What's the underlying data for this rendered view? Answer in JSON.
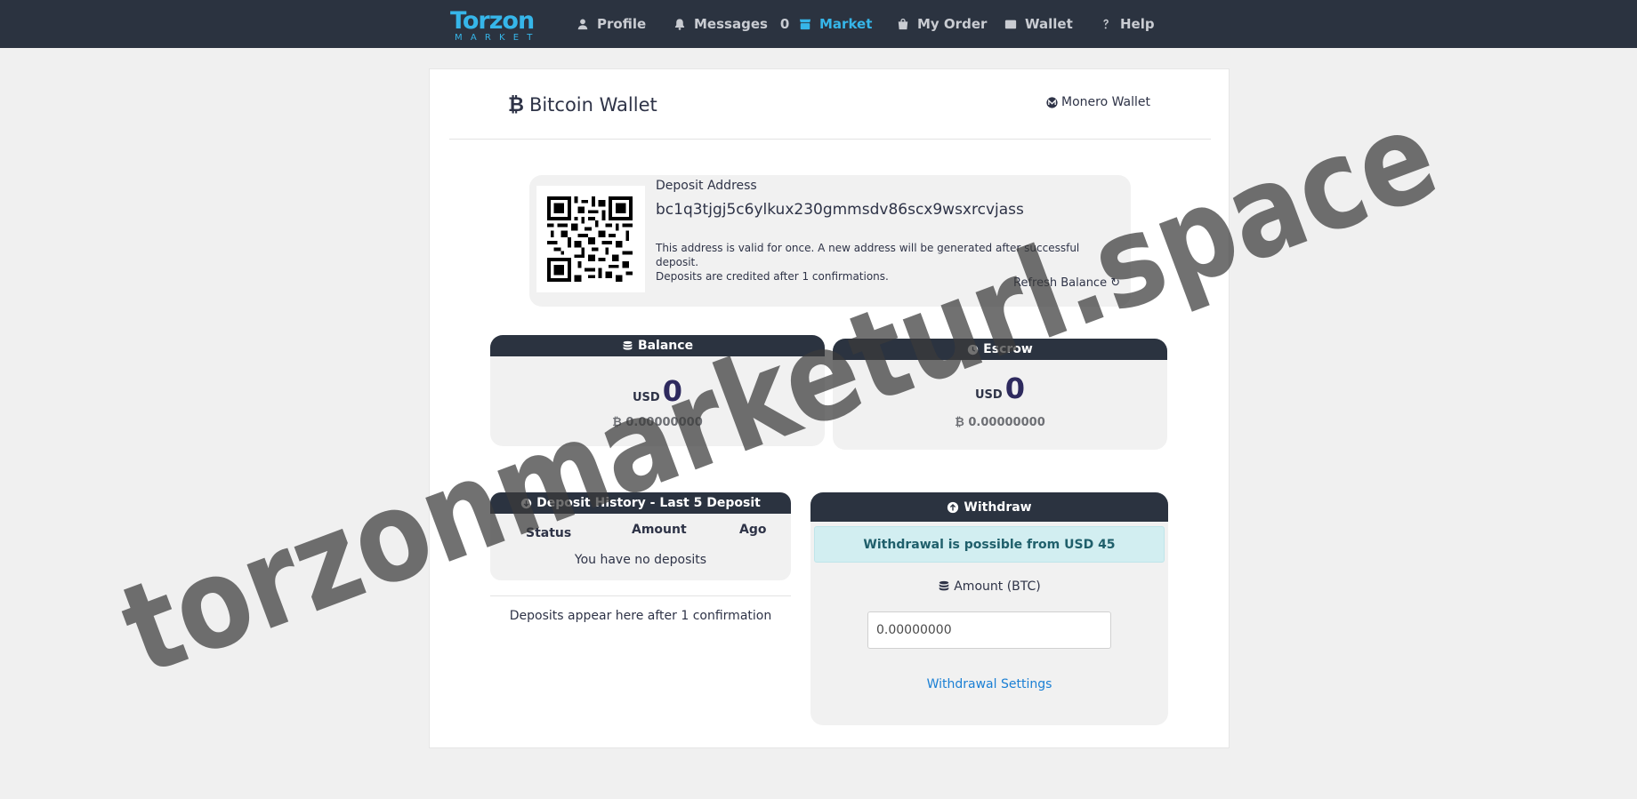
{
  "nav": {
    "logo_top": "Torzon",
    "logo_bottom": "MARKET",
    "items": [
      {
        "label": "Profile",
        "icon": "user-icon"
      },
      {
        "label": "Messages",
        "icon": "bell-icon",
        "count": "0"
      },
      {
        "label": "Market",
        "icon": "store-icon"
      },
      {
        "label": "My Order",
        "icon": "bag-icon"
      },
      {
        "label": "Wallet",
        "icon": "wallet-icon"
      },
      {
        "label": "Help",
        "icon": "question-icon"
      }
    ],
    "active": "Market"
  },
  "wallet": {
    "title": "Bitcoin Wallet",
    "btc_symbol": "₿",
    "monero_link": "Monero Wallet"
  },
  "deposit": {
    "label": "Deposit Address",
    "address": "bc1q3tjgj5c6ylkux230gmmsdv86scx9wsxrcvjass",
    "note_line1": "This address is valid for once. A new address will be generated after successful deposit.",
    "note_line2": "Deposits are credited after 1 confirmations.",
    "refresh": "Refresh Balance ↻"
  },
  "balance": {
    "title": "Balance",
    "currency": "USD",
    "usd": "0",
    "btc": "₿ 0.00000000"
  },
  "escrow": {
    "title": "Escrow",
    "currency": "USD",
    "usd": "0",
    "btc": "₿ 0.00000000"
  },
  "history": {
    "title": "Deposit History - Last 5 Deposit",
    "columns": [
      "Status",
      "Amount",
      "Ago"
    ],
    "empty": "You have no deposits",
    "note": "Deposits appear here after 1 confirmation"
  },
  "withdraw": {
    "title": "Withdraw",
    "alert": "Withdrawal is possible from USD 45",
    "amount_label": "Amount (BTC)",
    "amount_value": "0.00000000",
    "settings_link": "Withdrawal Settings"
  },
  "watermark": "torzonmarketurl.space",
  "colors": {
    "navbar": "#2b3340",
    "accent": "#36b6e9",
    "link": "#1a7fd4",
    "alert_bg": "#d2eef1"
  }
}
